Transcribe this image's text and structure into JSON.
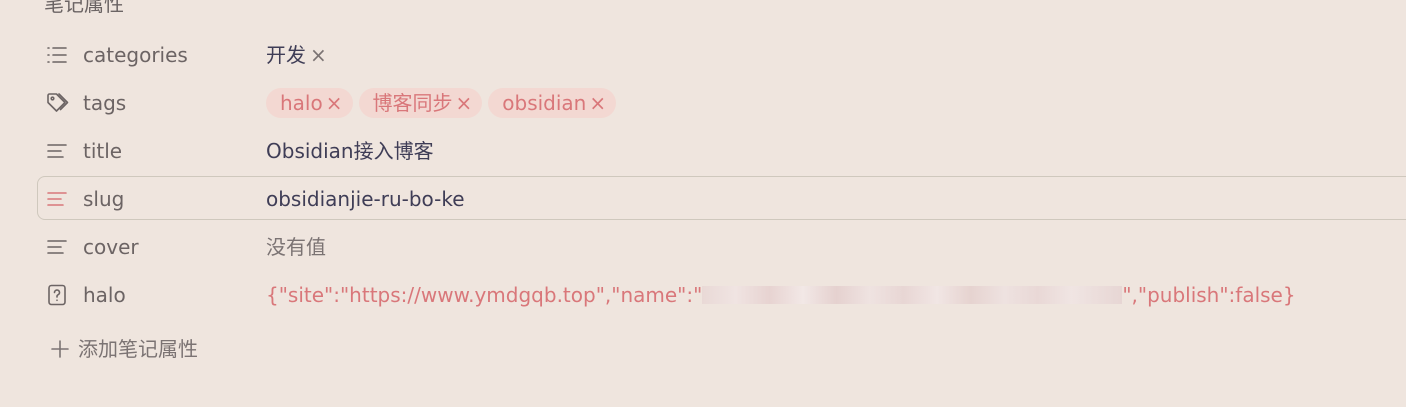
{
  "panel": {
    "title": "笔记属性"
  },
  "properties": [
    {
      "key": "categories",
      "icon": "list-icon",
      "values": [
        "开发"
      ]
    },
    {
      "key": "tags",
      "icon": "tags-icon",
      "values": [
        "halo",
        "博客同步",
        "obsidian"
      ]
    },
    {
      "key": "title",
      "icon": "text-icon",
      "value": "Obsidian接入博客"
    },
    {
      "key": "slug",
      "icon": "text-icon",
      "value": "obsidianjie-ru-bo-ke",
      "active": true
    },
    {
      "key": "cover",
      "icon": "text-icon",
      "placeholder": "没有值"
    },
    {
      "key": "halo",
      "icon": "unknown-type-icon",
      "value_prefix": "{\"site\":\"https://www.ymdgqb.top\",\"name\":\"",
      "value_suffix": "\",\"publish\":false}"
    }
  ],
  "remove_glyph": "×",
  "add_property": {
    "label": "添加笔记属性"
  },
  "colors": {
    "background": "#efe5de",
    "accent": "#d9777a",
    "tag_background": "#f3d8d2",
    "text": "#3f3d56",
    "muted": "#6c6464"
  }
}
